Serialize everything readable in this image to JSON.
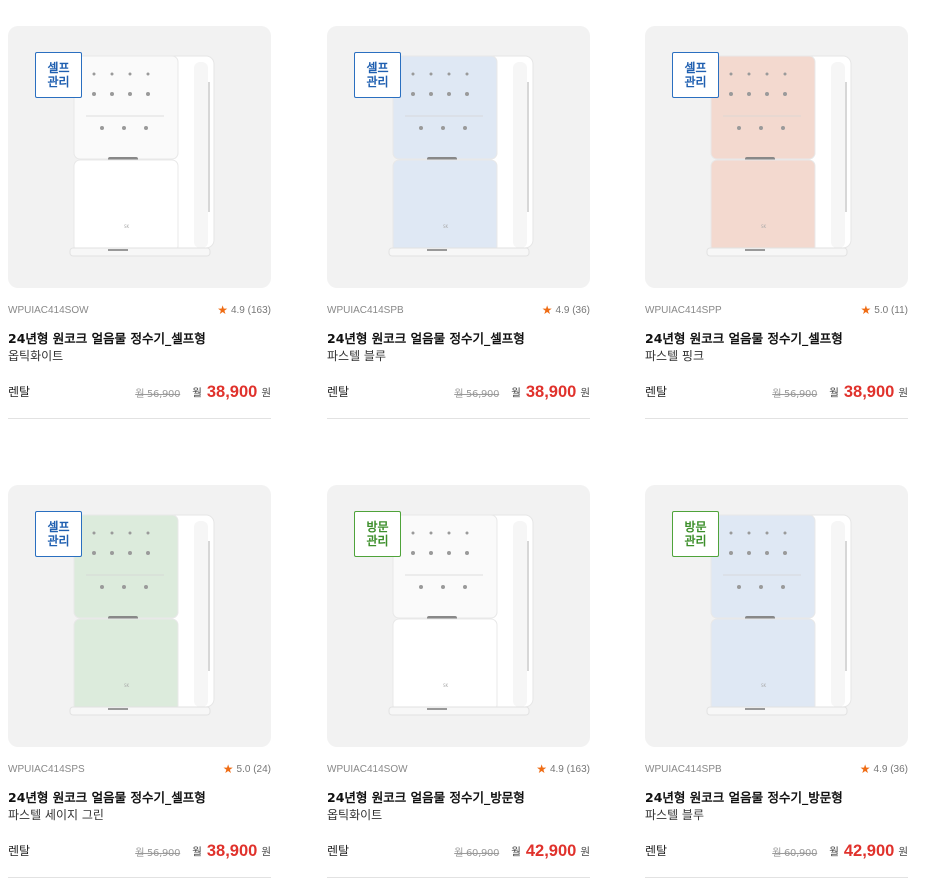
{
  "products": [
    {
      "model": "WPUIAC414SOW",
      "rating": "4.9",
      "reviews": "(163)",
      "title": "24년형 원코크 얼음물 정수기_셀프형",
      "color_name": "옵틱화이트",
      "badge": "셀프\n관리",
      "badge_type": "self",
      "rental_label": "렌탈",
      "original_price": "월 56,900",
      "price_prefix": "월",
      "price": "38,900",
      "price_suffix": "원",
      "panel_color": "#fafafa",
      "body_color": "#ffffff"
    },
    {
      "model": "WPUIAC414SPB",
      "rating": "4.9",
      "reviews": "(36)",
      "title": "24년형 원코크 얼음물 정수기_셀프형",
      "color_name": "파스텔 블루",
      "badge": "셀프\n관리",
      "badge_type": "self",
      "rental_label": "렌탈",
      "original_price": "월 56,900",
      "price_prefix": "월",
      "price": "38,900",
      "price_suffix": "원",
      "panel_color": "#dfe8f4",
      "body_color": "#ffffff"
    },
    {
      "model": "WPUIAC414SPP",
      "rating": "5.0",
      "reviews": "(11)",
      "title": "24년형 원코크 얼음물 정수기_셀프형",
      "color_name": "파스텔 핑크",
      "badge": "셀프\n관리",
      "badge_type": "self",
      "rental_label": "렌탈",
      "original_price": "월 56,900",
      "price_prefix": "월",
      "price": "38,900",
      "price_suffix": "원",
      "panel_color": "#f3d9cf",
      "body_color": "#ffffff"
    },
    {
      "model": "WPUIAC414SPS",
      "rating": "5.0",
      "reviews": "(24)",
      "title": "24년형 원코크 얼음물 정수기_셀프형",
      "color_name": "파스텔 세이지 그린",
      "badge": "셀프\n관리",
      "badge_type": "self",
      "rental_label": "렌탈",
      "original_price": "월 56,900",
      "price_prefix": "월",
      "price": "38,900",
      "price_suffix": "원",
      "panel_color": "#dcebdc",
      "body_color": "#ffffff"
    },
    {
      "model": "WPUIAC414SOW",
      "rating": "4.9",
      "reviews": "(163)",
      "title": "24년형 원코크 얼음물 정수기_방문형",
      "color_name": "옵틱화이트",
      "badge": "방문\n관리",
      "badge_type": "visit",
      "rental_label": "렌탈",
      "original_price": "월 60,900",
      "price_prefix": "월",
      "price": "42,900",
      "price_suffix": "원",
      "panel_color": "#fafafa",
      "body_color": "#ffffff"
    },
    {
      "model": "WPUIAC414SPB",
      "rating": "4.9",
      "reviews": "(36)",
      "title": "24년형 원코크 얼음물 정수기_방문형",
      "color_name": "파스텔 블루",
      "badge": "방문\n관리",
      "badge_type": "visit",
      "rental_label": "렌탈",
      "original_price": "월 60,900",
      "price_prefix": "월",
      "price": "42,900",
      "price_suffix": "원",
      "panel_color": "#dfe8f4",
      "body_color": "#ffffff"
    }
  ],
  "colors": {
    "price_accent": "#e0322c",
    "star": "#ef6c14",
    "self_badge": "#1f5fb0",
    "visit_badge": "#3d8f2b"
  },
  "icons": {
    "star": "star-icon"
  }
}
